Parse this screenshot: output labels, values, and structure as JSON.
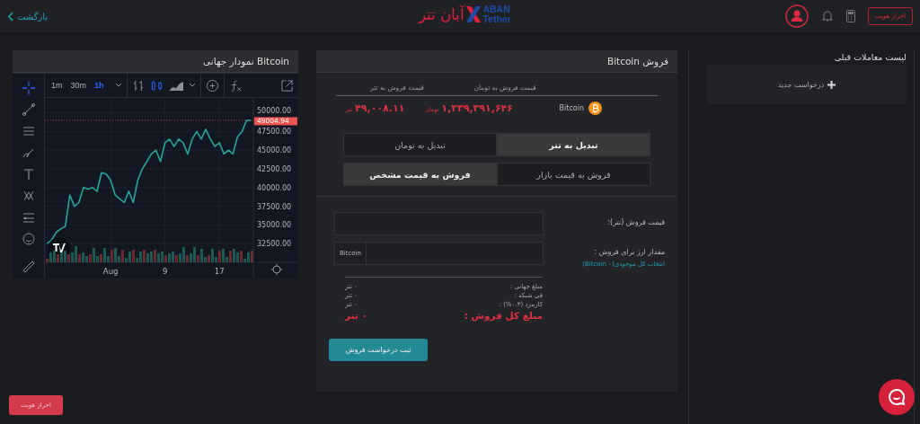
{
  "header": {
    "back_label": "بازگشت",
    "logo": {
      "persian": "آبان تتر",
      "latin_top": "ABAN",
      "latin_bottom": "Tether"
    },
    "verify_button": "احراز هویت"
  },
  "chart_panel": {
    "title": "نمودار جهانی Bitcoin",
    "intervals": [
      {
        "label": "1h",
        "selected": true
      },
      {
        "label": "30m",
        "selected": false
      },
      {
        "label": "1m",
        "selected": false
      }
    ],
    "chart_data": {
      "type": "line",
      "categories": [
        null,
        null,
        null,
        null,
        null,
        null,
        null,
        null,
        null,
        null,
        null,
        null,
        null,
        null,
        "Aug",
        null,
        null,
        null,
        null,
        null,
        null,
        null,
        null,
        null,
        null,
        null,
        "9",
        null,
        null,
        null,
        null,
        null,
        null,
        null,
        null,
        null,
        null,
        null,
        "17",
        null,
        null,
        null,
        null,
        null,
        null,
        null
      ],
      "series": [
        {
          "color": "#26a69a",
          "values": [
            32500,
            33000,
            34000,
            34500,
            34800,
            39000,
            37500,
            38000,
            40000,
            39800,
            40000,
            39500,
            42000,
            41800,
            41000,
            39000,
            38500,
            38000,
            39500,
            38000,
            41000,
            42500,
            43500,
            44500,
            45000,
            43500,
            46000,
            46500,
            45500,
            46500,
            46000,
            44500,
            46500,
            47500,
            46500,
            47800,
            46500,
            45500,
            46000,
            44500,
            45000,
            44500,
            46800,
            47500,
            49000,
            49000
          ]
        }
      ],
      "ylim": [
        30000,
        52000
      ],
      "grid": true,
      "ref_lines": [
        {
          "axis": "y",
          "value": 49004.94,
          "label": "49004.94",
          "color": "#ef5350"
        }
      ],
      "yticks": [
        {
          "value": 32500,
          "label": "32500.00"
        },
        {
          "value": 35000,
          "label": "35000.00"
        },
        {
          "value": 37500,
          "label": "37500.00"
        },
        {
          "value": 40000,
          "label": "40000.00"
        },
        {
          "value": 42500,
          "label": "42500.00"
        },
        {
          "value": 45000,
          "label": "45000.00"
        },
        {
          "value": 47500,
          "label": "47500.00"
        },
        {
          "value": 50000,
          "label": "50000.00"
        }
      ]
    }
  },
  "sell_panel": {
    "title": "فروش Bitcoin",
    "price_table": {
      "columns": [
        "قیمت فروش به تومان",
        "قیمت فروش به تتر"
      ],
      "coin": "Bitcoin",
      "toman_price": "۱,۳۳۹,۳۹۱,۶۴۶",
      "toman_unit": "تومان",
      "usdt_price": "۴۹,۰۰۸.۱۱",
      "usdt_unit": "تتر"
    },
    "convert_tabs": [
      {
        "label": "تبدیل به تتر",
        "selected": true
      },
      {
        "label": "تبدیل به تومان",
        "selected": false
      }
    ],
    "order_tabs": [
      {
        "label": "فروش به قیمت بازار",
        "selected": false
      },
      {
        "label": "فروش به قیمت مشخص",
        "selected": true
      }
    ],
    "price_field": {
      "label": "قیمت فروش (تتر):"
    },
    "amount_field": {
      "label": "مقدار ارز برای فروش :",
      "addon": "Bitcoin",
      "select_all_link": "انتخاب کل موجودی(۰ Bitcoin)"
    },
    "summary": [
      {
        "label": "مبلغ جهانی :",
        "value": "۰ تتر",
        "kind": "normal"
      },
      {
        "label": "فی شبکه :",
        "value": "۰ تتر",
        "kind": "normal"
      },
      {
        "label": "کارمزد (۰.۳%) :",
        "value": "۰ تتر",
        "kind": "normal"
      },
      {
        "label": "مبلغ کل فروش :",
        "value": "۰ تتر",
        "kind": "total"
      }
    ],
    "submit_button": "ثبت درخواست فروش"
  },
  "history_panel": {
    "title": "لیست معاملات قبلی",
    "new_request": "درخواست جدید"
  },
  "floating_verify_button": "احراز هویت"
}
